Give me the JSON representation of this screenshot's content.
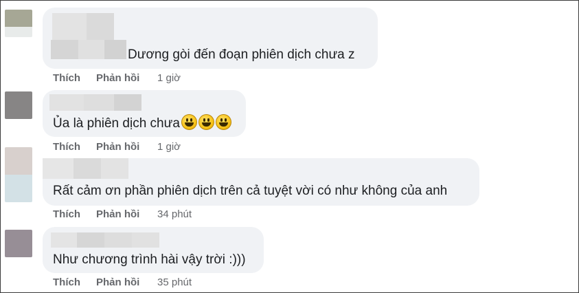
{
  "comments": [
    {
      "text": "Dương gòi đến đoạn phiên dịch chưa z",
      "like": "Thích",
      "reply": "Phản hồi",
      "time": "1 giờ",
      "avatar_colors": [
        "#a6a795",
        "#e8ebea"
      ]
    },
    {
      "text": "Ủa là phiên dịch chưa",
      "emoji_count": 3,
      "like": "Thích",
      "reply": "Phản hồi",
      "time": "1 giờ",
      "avatar_colors": [
        "#878585"
      ]
    },
    {
      "text": "Rất cảm ơn phần phiên dịch trên cả tuyệt vời có như không của anh",
      "like": "Thích",
      "reply": "Phản hồi",
      "time": "34 phút",
      "avatar_colors": [
        "#d8d0cd",
        "#d3e1e6"
      ]
    },
    {
      "text": "Như chương trình hài vậy trời :)))",
      "like": "Thích",
      "reply": "Phản hồi",
      "time": "35 phút",
      "avatar_colors": [
        "#978e96"
      ]
    }
  ],
  "colors": {
    "bubble": "#f0f2f5",
    "action_text": "#65676b",
    "name_blur": "#dcdcdc",
    "emoji": "#f7c31a"
  },
  "icons": [
    "grinning-face-emoji"
  ]
}
